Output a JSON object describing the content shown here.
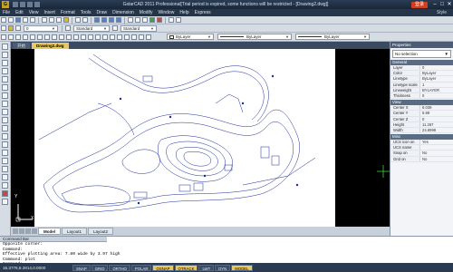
{
  "window": {
    "title": "GstarCAD 2011 Professional[Trial period is expired, some functions will be restricted - [Drawing2.dwg]]",
    "login_label": "登录",
    "minimize": "–",
    "maximize": "□",
    "close": "✕"
  },
  "menubar": {
    "items": [
      "File",
      "Edit",
      "View",
      "Insert",
      "Format",
      "Tools",
      "Draw",
      "Dimension",
      "Modify",
      "Window",
      "Help",
      "Express"
    ],
    "style_label": "Style"
  },
  "toolbar": {
    "layer_combo": "0",
    "text_style_combo": "Standard",
    "dim_style_combo": "Standard",
    "color_combo": "ByLayer",
    "linetype_combo": "ByLayer",
    "lineweight_combo": "ByLayer"
  },
  "doc_tabs": [
    {
      "label": "开始",
      "active": false
    },
    {
      "label": "Drawing2.dwg",
      "active": true
    }
  ],
  "layout_tabs": [
    "Model",
    "Layout1",
    "Layout2"
  ],
  "properties": {
    "header": "Properties",
    "selection": "No selection",
    "sections": [
      {
        "name": "General",
        "rows": [
          {
            "k": "Color",
            "v": "ByLayer"
          },
          {
            "k": "Layer",
            "v": "0"
          },
          {
            "k": "Linetype",
            "v": "ByLayer"
          },
          {
            "k": "Linetype scale",
            "v": "1"
          },
          {
            "k": "Lineweight",
            "v": "BYLAYER"
          },
          {
            "k": "Thickness",
            "v": "0"
          }
        ]
      },
      {
        "name": "View",
        "rows": [
          {
            "k": "Center X",
            "v": "8.039"
          },
          {
            "k": "Center Y",
            "v": "5.98"
          },
          {
            "k": "Center Z",
            "v": "0"
          },
          {
            "k": "Height",
            "v": "11.267"
          },
          {
            "k": "Width",
            "v": "24.6999"
          }
        ]
      },
      {
        "name": "Misc",
        "rows": [
          {
            "k": "UCS icon on",
            "v": "Yes"
          },
          {
            "k": "UCS name",
            "v": ""
          },
          {
            "k": "Snap on",
            "v": "No"
          },
          {
            "k": "Grid on",
            "v": "No"
          }
        ]
      }
    ]
  },
  "command": {
    "header": "Command Bar",
    "lines": [
      "Opposite corner:",
      "Command:",
      "Effective plotting area: 7.80 wide by 3.97 high",
      "Command: plot",
      "Command:"
    ]
  },
  "status": {
    "coords": "15.3776,8.2814,0.0000",
    "toggles": [
      {
        "label": "SNAP",
        "on": false
      },
      {
        "label": "GRID",
        "on": false
      },
      {
        "label": "ORTHO",
        "on": false
      },
      {
        "label": "POLAR",
        "on": false
      },
      {
        "label": "OSNAP",
        "on": true
      },
      {
        "label": "OTRACK",
        "on": true
      },
      {
        "label": "LWT",
        "on": false
      },
      {
        "label": "DYN",
        "on": false
      },
      {
        "label": "MODEL",
        "on": true
      }
    ]
  },
  "ucs_labels": {
    "x": "X",
    "y": "Y"
  }
}
